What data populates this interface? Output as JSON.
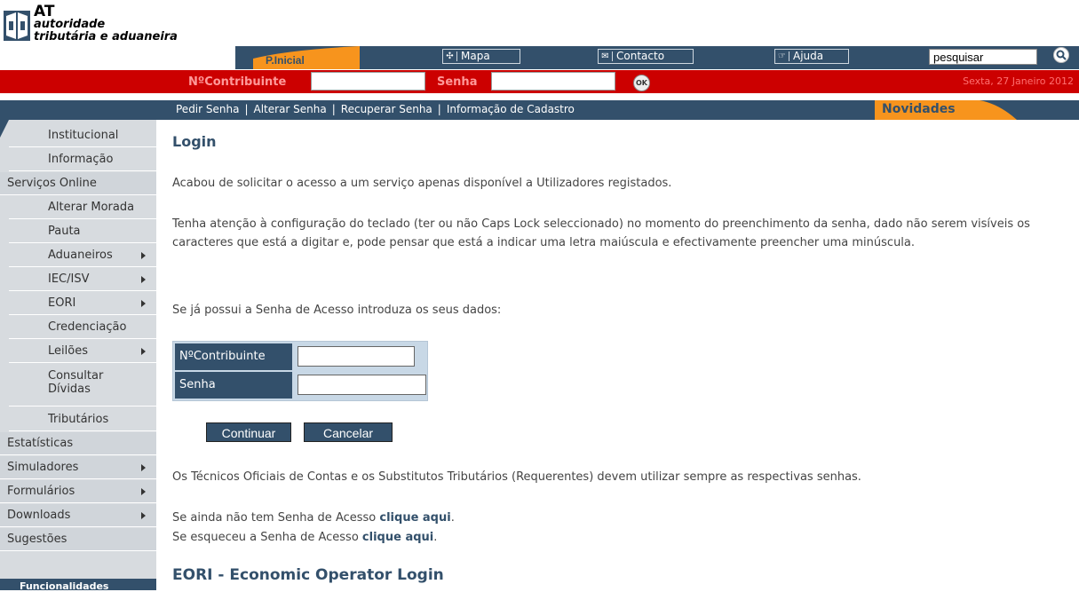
{
  "logo": {
    "at": "AT",
    "line2": "autoridade",
    "line3": "tributária e aduaneira"
  },
  "top_nav": {
    "inicial": "P.Inicial",
    "links": [
      {
        "label": "Mapa",
        "icon": "map-icon"
      },
      {
        "label": "Contacto",
        "icon": "mail-icon"
      },
      {
        "label": "Ajuda",
        "icon": "help-icon"
      }
    ],
    "search_value": "pesquisar"
  },
  "login_bar": {
    "contribuinte_label": "NºContribuinte",
    "senha_label": "Senha",
    "ok_label": "OK",
    "date": "Sexta, 27 Janeiro 2012"
  },
  "sub_nav": {
    "links": [
      "Pedir Senha",
      "Alterar Senha",
      "Recuperar Senha",
      "Informação de Cadastro"
    ],
    "novidades": "Novidades"
  },
  "sidebar": {
    "items": [
      {
        "label": "Institucional",
        "level": "sub",
        "arrow": false
      },
      {
        "label": "Informação",
        "level": "sub",
        "arrow": false
      },
      {
        "label": "Serviços Online",
        "level": "top",
        "arrow": false
      },
      {
        "label": "Alterar Morada",
        "level": "sub",
        "arrow": false
      },
      {
        "label": "Pauta",
        "level": "sub",
        "arrow": false
      },
      {
        "label": "Aduaneiros",
        "level": "sub",
        "arrow": true
      },
      {
        "label": "IEC/ISV",
        "level": "sub",
        "arrow": true
      },
      {
        "label": "EORI",
        "level": "sub",
        "arrow": true
      },
      {
        "label": "Credenciação",
        "level": "sub",
        "arrow": false
      },
      {
        "label": "Leilões",
        "level": "sub",
        "arrow": true
      },
      {
        "label": "Consultar Dívidas",
        "level": "sub",
        "arrow": false
      },
      {
        "label": "Tributários",
        "level": "sub",
        "arrow": false
      },
      {
        "label": "Estatísticas",
        "level": "top",
        "arrow": false
      },
      {
        "label": "Simuladores",
        "level": "top",
        "arrow": true
      },
      {
        "label": "Formulários",
        "level": "top",
        "arrow": true
      },
      {
        "label": "Downloads",
        "level": "top",
        "arrow": true
      },
      {
        "label": "Sugestões",
        "level": "top",
        "arrow": false
      }
    ],
    "bottom_label": "Funcionalidades"
  },
  "main": {
    "title": "Login",
    "p1": "Acabou de solicitar o acesso a um serviço apenas disponível a Utilizadores registados.",
    "p2": "Tenha atenção à configuração do teclado (ter ou não Caps Lock seleccionado) no momento do preenchimento da senha, dado não serem visíveis os caracteres que está a digitar e, pode pensar que está a indicar uma letra maiúscula e efectivamente preencher uma minúscula.",
    "p3": "Se já possui a Senha de Acesso introduza os seus dados:",
    "form": {
      "contribuinte_label": "NºContribuinte",
      "senha_label": "Senha"
    },
    "continuar": "Continuar",
    "cancelar": "Cancelar",
    "p4": "Os Técnicos Oficiais de Contas e os Substitutos Tributários (Requerentes) devem utilizar sempre as respectivas senhas.",
    "p5_prefix": "Se ainda não tem Senha de Acesso ",
    "p6_prefix": "Se esqueceu a Senha de Acesso ",
    "link_text": "clique aqui",
    "period": ".",
    "eori_title": "EORI - Economic Operator Login"
  },
  "colors": {
    "navy": "#33506b",
    "red": "#cc0000",
    "orange": "#f7941d",
    "sidebar": "#d7dbdf"
  }
}
